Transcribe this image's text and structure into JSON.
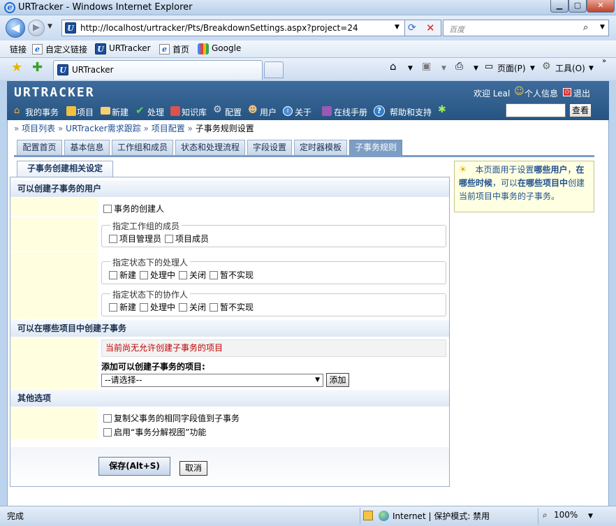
{
  "window": {
    "title": "URTracker - Windows Internet Explorer"
  },
  "address": {
    "url": "http://localhost/urtracker/Pts/BreakdownSettings.aspx?project=24",
    "search_placeholder": "百度"
  },
  "links_bar": {
    "label": "链接",
    "items": [
      "自定义链接",
      "URTracker",
      "首页",
      "Google"
    ]
  },
  "browser_tab": {
    "label": "URTracker"
  },
  "toolbar": {
    "page": "页面(P)",
    "tools": "工具(O)"
  },
  "header": {
    "logo": "URTRACKER",
    "welcome": "欢迎 Leal",
    "profile": "个人信息",
    "logout": "退出",
    "nav": [
      "我的事务",
      "项目",
      "新建",
      "处理",
      "知识库",
      "配置",
      "用户",
      "关于",
      "在线手册",
      "帮助和支持"
    ],
    "search_button": "查看"
  },
  "breadcrumb": [
    "项目列表",
    "URTracker需求跟踪",
    "项目配置",
    "子事务规则设置"
  ],
  "config_tabs": [
    "配置首页",
    "基本信息",
    "工作组和成员",
    "状态和处理流程",
    "字段设置",
    "定时器模板",
    "子事务规则"
  ],
  "subtab": "子事务创建相关设定",
  "section_users": {
    "title": "可以创建子事务的用户",
    "creator": "事务的创建人",
    "group_legend": "指定工作组的成员",
    "group_opts": [
      "项目管理员",
      "项目成员"
    ],
    "handler_legend": "指定状态下的处理人",
    "status_opts": [
      "新建",
      "处理中",
      "关闭",
      "暂不实现"
    ],
    "collab_legend": "指定状态下的协作人"
  },
  "section_projects": {
    "title": "可以在哪些项目中创建子事务",
    "notice": "当前尚无允许创建子事务的项目",
    "add_label": "添加可以创建子事务的项目:",
    "select_value": "--请选择--",
    "add_button": "添加"
  },
  "section_other": {
    "title": "其他选项",
    "opt1": "复制父事务的相同字段值到子事务",
    "opt2": "启用“事务分解视图”功能"
  },
  "buttons": {
    "save": "保存(Alt+S)",
    "cancel": "取消"
  },
  "tip": {
    "pre": "本页面用于设置",
    "b1": "哪些用户",
    "b2": "在哪些时候",
    "mid": "，可以",
    "b3": "在哪些项目中",
    "post": "创建当前项目中事务的子事务。"
  },
  "status": {
    "left": "完成",
    "zone": "Internet | 保护模式: 禁用",
    "zoom": "100%"
  }
}
